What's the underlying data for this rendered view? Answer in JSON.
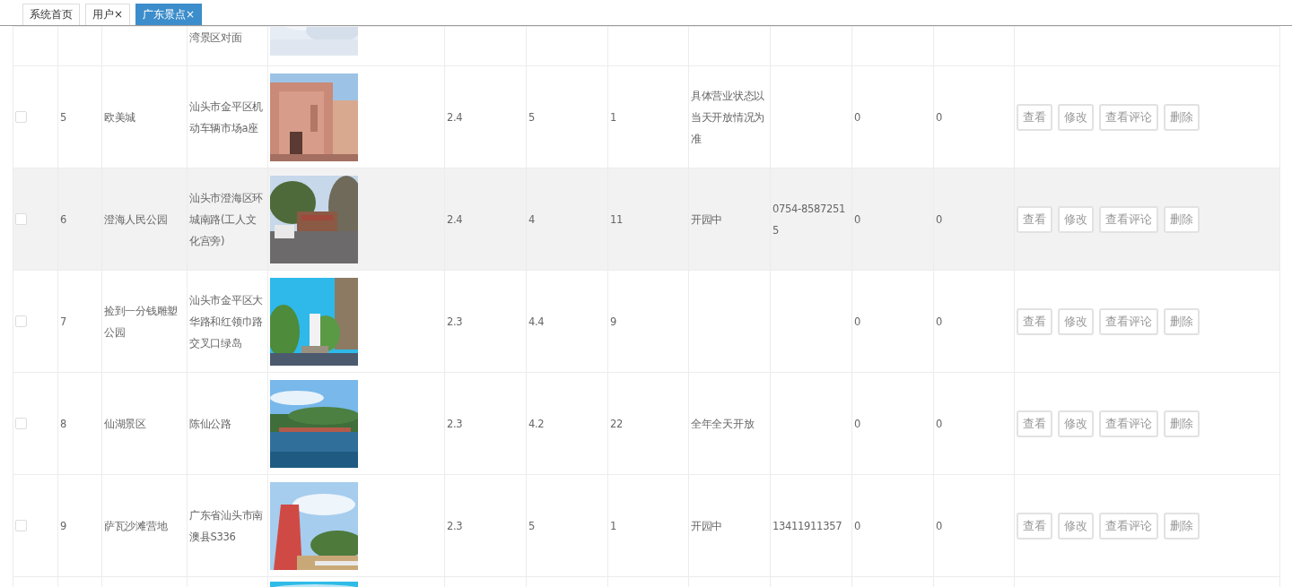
{
  "tabs": [
    {
      "label": "系统首页",
      "selected": false
    },
    {
      "label": "用户",
      "close": "×",
      "selected": false
    },
    {
      "label": "广东景点",
      "close": "×",
      "selected": true
    }
  ],
  "table": {
    "rows": [
      {
        "cells": {
          "column_4": "湾景区对面"
        }
      },
      {
        "checked": false,
        "highlighted": false,
        "cells": {
          "column_2": "5",
          "column_3": "欧美城",
          "column_4": "汕头市金平区机动车辆市场a座",
          "column_6": "2.4",
          "column_7": "5",
          "column_8": "1",
          "column_9": "具体营业状态以当天开放情况为准",
          "column_11": "0",
          "column_12": "0"
        },
        "actions": [
          "查看",
          "修改",
          "查看评论",
          "删除"
        ]
      },
      {
        "checked": false,
        "highlighted": true,
        "cells": {
          "column_2": "6",
          "column_3": "澄海人民公园",
          "column_4": "汕头市澄海区环城南路(工人文化宫旁)",
          "column_6": "2.4",
          "column_7": "4",
          "column_8": "11",
          "column_9": "开园中",
          "column_10": "0754-85872515",
          "column_11": "0",
          "column_12": "0"
        },
        "actions": [
          "查看",
          "修改",
          "查看评论",
          "删除"
        ]
      },
      {
        "checked": false,
        "highlighted": false,
        "cells": {
          "column_2": "7",
          "column_3": "捡到一分钱雕塑公园",
          "column_4": "汕头市金平区大华路和红领巾路交叉口绿岛",
          "column_6": "2.3",
          "column_7": "4.4",
          "column_8": "9",
          "column_11": "0",
          "column_12": "0"
        },
        "actions": [
          "查看",
          "修改",
          "查看评论",
          "删除"
        ]
      },
      {
        "checked": false,
        "highlighted": false,
        "cells": {
          "column_2": "8",
          "column_3": "仙湖景区",
          "column_4": "陈仙公路",
          "column_6": "2.3",
          "column_7": "4.2",
          "column_8": "22",
          "column_9": "全年全天开放",
          "column_11": "0",
          "column_12": "0"
        },
        "actions": [
          "查看",
          "修改",
          "查看评论",
          "删除"
        ]
      },
      {
        "checked": false,
        "highlighted": false,
        "cells": {
          "column_2": "9",
          "column_3": "萨瓦沙滩营地",
          "column_4": "广东省汕头市南澳县S336",
          "column_6": "2.3",
          "column_7": "5",
          "column_8": "1",
          "column_9": "开园中",
          "column_10": "13411911357",
          "column_11": "0",
          "column_12": "0"
        },
        "actions": [
          "查看",
          "修改",
          "查看评论",
          "删除"
        ]
      },
      {
        "cells": {}
      }
    ]
  }
}
